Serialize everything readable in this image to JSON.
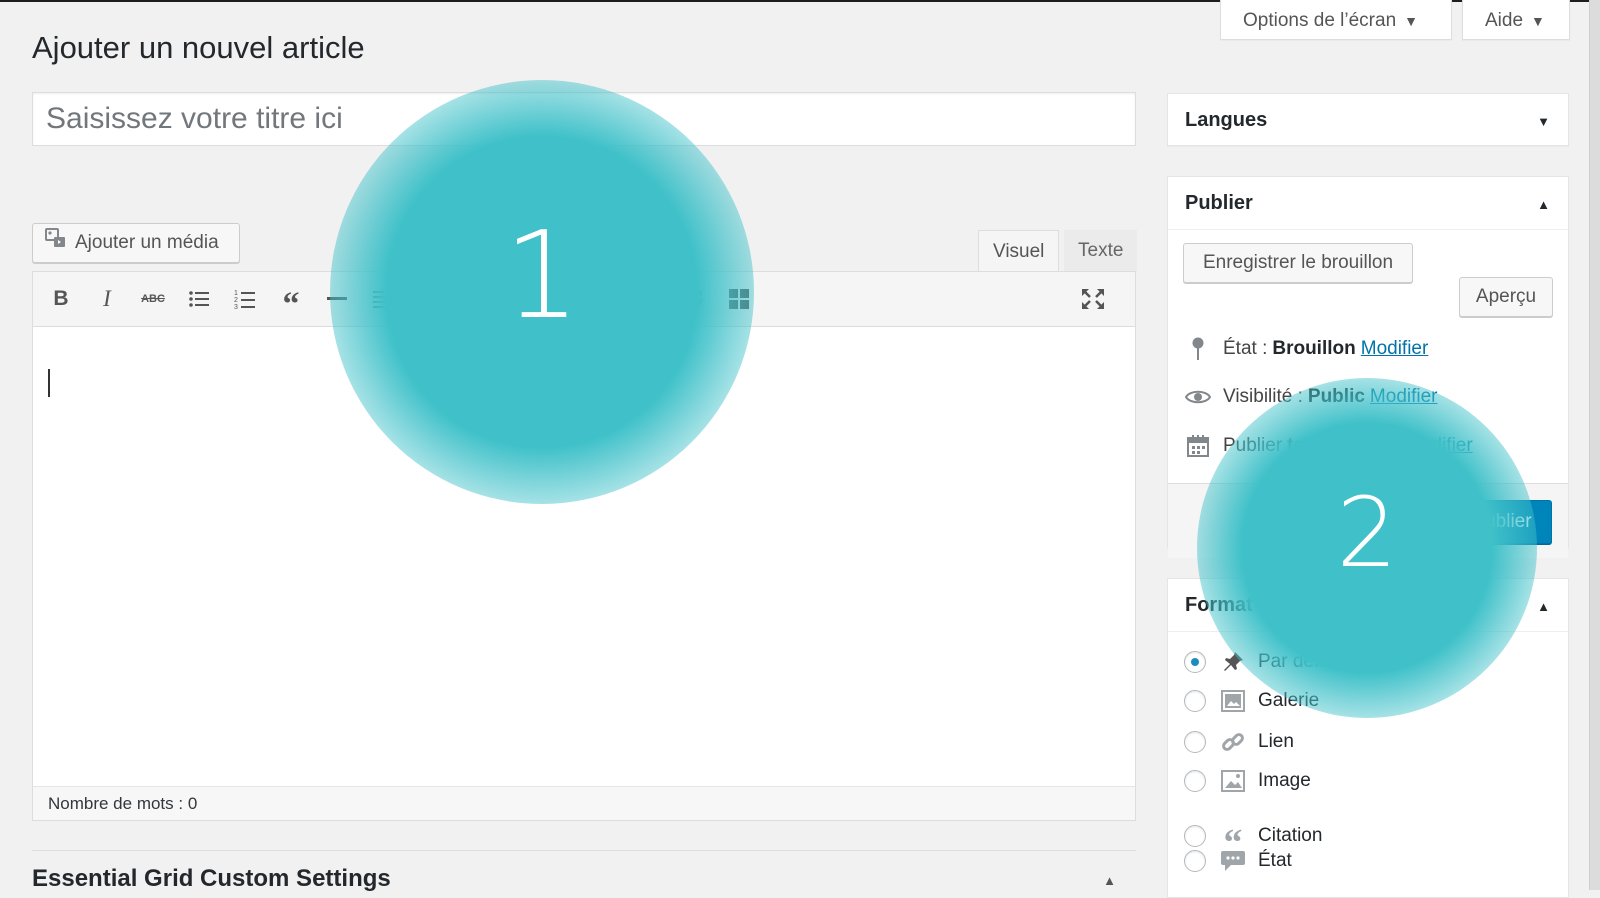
{
  "header": {
    "screen_options": "Options de l’écran",
    "help": "Aide",
    "page_title": "Ajouter un nouvel article"
  },
  "post": {
    "title_placeholder": "Saisissez votre titre ici"
  },
  "editor": {
    "add_media": "Ajouter un média",
    "tabs": [
      "Visuel",
      "Texte"
    ],
    "toolbar_icons": [
      "bold-icon",
      "italic-icon",
      "strikethrough-icon",
      "bullet-list-icon",
      "numbered-list-icon",
      "blockquote-icon",
      "horizontal-rule-icon",
      "align-left-icon",
      "align-center-icon",
      "toolbar-toggle-icon",
      "refresh-icon",
      "grid-icon",
      "fullscreen-icon"
    ],
    "word_count": "Nombre de mots : 0"
  },
  "metabox": {
    "title": "Essential Grid Custom Settings"
  },
  "sidebar": {
    "languages": {
      "title": "Langues"
    },
    "publish": {
      "title": "Publier",
      "save_draft": "Enregistrer le brouillon",
      "preview": "Aperçu",
      "status_label": "État :",
      "status_value": "Brouillon",
      "visibility_label": "Visibilité :",
      "visibility_value": "Public",
      "schedule_label": "Publier",
      "schedule_value": "tout de suite",
      "edit_link": "Modifier",
      "publish_button": "Publier"
    },
    "format": {
      "title": "Format",
      "options": [
        {
          "label": "Par défaut",
          "icon": "pin-icon",
          "selected": true
        },
        {
          "label": "Galerie",
          "icon": "gallery-icon",
          "selected": false
        },
        {
          "label": "Lien",
          "icon": "link-icon",
          "selected": false
        },
        {
          "label": "Image",
          "icon": "image-icon",
          "selected": false
        },
        {
          "label": "Citation",
          "icon": "quote-icon",
          "selected": false
        },
        {
          "label": "État",
          "icon": "chat-bubble-icon",
          "selected": false
        }
      ]
    }
  },
  "overlay": {
    "spot1": "1",
    "spot2": "2",
    "color": "#40c1c9"
  },
  "colors": {
    "link": "#0073aa",
    "primary_button": "#0085ba",
    "background": "#f1f1f1"
  }
}
